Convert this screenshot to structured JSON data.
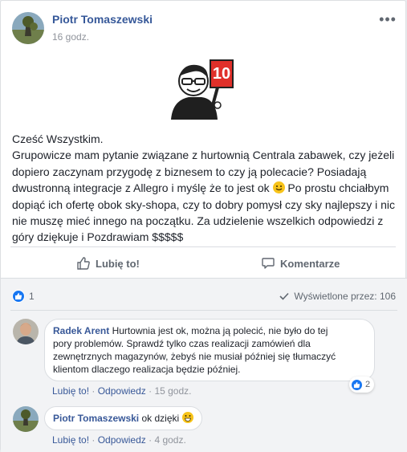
{
  "post": {
    "author": "Piotr Tomaszewski",
    "time": "16 godz.",
    "paragraphs": [
      "Cześć Wszystkim.",
      "Grupowicze mam pytanie związane z hurtownią Centrala zabawek, czy jeżeli dopiero zaczynam przygodę z biznesem to czy ją polecacie? Posiadają dwustronną integracje z Allegro i myślę że to jest ok",
      "Po prostu chciałbym dopiąć ich ofertę obok sky-shopa, czy to dobry pomysł czy sky najlepszy i nic nie muszę mieć innego na początku. Za udzielenie wszelkich odpowiedzi z góry dziękuje i Pozdrawiam $$$$$"
    ],
    "sticker_number": "10"
  },
  "actions": {
    "like": "Lubię to!",
    "comment": "Komentarze"
  },
  "stats": {
    "likes": "1",
    "views": "Wyświetlone przez: 106"
  },
  "comments": [
    {
      "author": "Radek Arent",
      "text_line1": "Hurtownia jest ok, można ją polecić, nie było do tej",
      "text_line2": "pory problemów. Sprawdź tylko czas realizacji zamówień dla",
      "text_line3": "zewnętrznych magazynów, żebyś nie musiał później się tłumaczyć",
      "text_line4": "klientom dlaczego realizacja będzie później.",
      "like_label": "Lubię to!",
      "reply_label": "Odpowiedz",
      "time": "15 godz.",
      "reactions": "2"
    },
    {
      "author": "Piotr Tomaszewski",
      "text": "ok dzięki",
      "like_label": "Lubię to!",
      "reply_label": "Odpowiedz",
      "time": "4 godz."
    }
  ],
  "colors": {
    "link": "#365899",
    "like_blue": "#1877f2",
    "emoji_yellow": "#f7c31a",
    "sticker_red": "#e0302a"
  }
}
